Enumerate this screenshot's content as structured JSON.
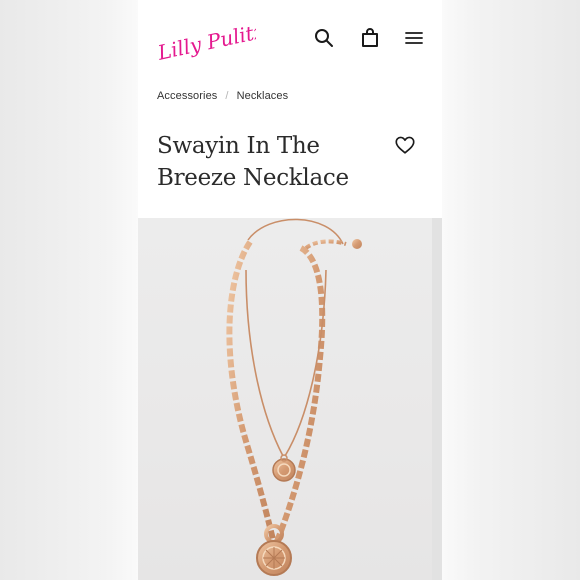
{
  "brand": {
    "name": "Lilly Pulitzer",
    "color": "#e4198f"
  },
  "header": {
    "icons": [
      "search-icon",
      "shopping-bag-icon",
      "hamburger-menu-icon"
    ]
  },
  "breadcrumb": {
    "items": [
      "Accessories",
      "Necklaces"
    ],
    "separator": "/"
  },
  "product": {
    "title": "Swayin In The Breeze Necklace",
    "wishlist_icon": "heart-outline-icon",
    "image": "gold layered chain necklace with two coin pendants"
  },
  "colors": {
    "gold": "#d8a77f",
    "background": "#ffffff",
    "text": "#2b2b2b"
  }
}
